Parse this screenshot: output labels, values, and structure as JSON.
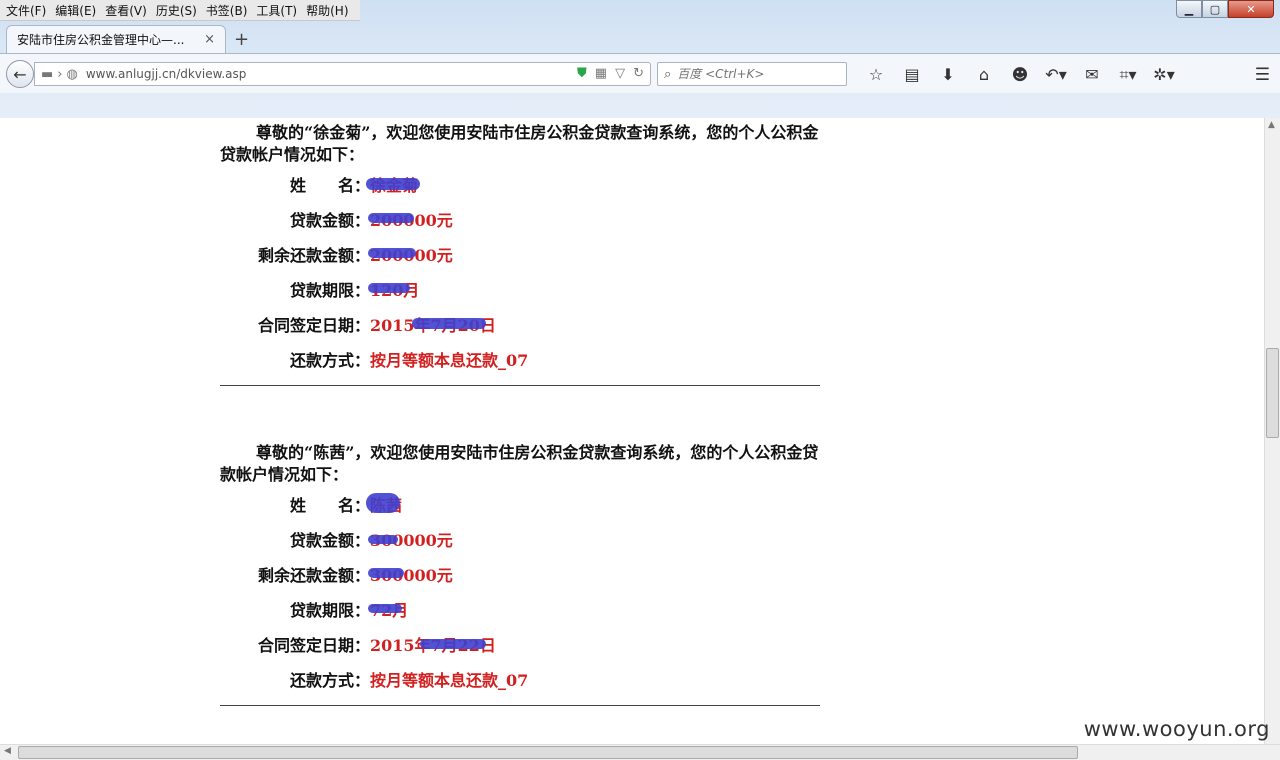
{
  "menu": [
    "文件(F)",
    "编辑(E)",
    "查看(V)",
    "历史(S)",
    "书签(B)",
    "工具(T)",
    "帮助(H)"
  ],
  "window": {
    "min": "▁",
    "max": "▢",
    "close": "✕"
  },
  "tab": {
    "title": "安陆市住房公积金管理中心—...",
    "close": "×",
    "new": "+"
  },
  "nav": {
    "url": "www.anlugjj.cn/dkview.asp",
    "search_placeholder": "百度 <Ctrl+K>"
  },
  "records": [
    {
      "intro": "尊敬的“徐金菊”，欢迎您使用安陆市住房公积金贷款查询系统，您的个人公积金贷款帐户情况如下：",
      "fields": [
        {
          "label": "姓　　名：",
          "value": "徐金菊"
        },
        {
          "label": "贷款金额：",
          "value": "200000元"
        },
        {
          "label": "剩余还款金额：",
          "value": "200000元"
        },
        {
          "label": "贷款期限：",
          "value": "120月"
        },
        {
          "label": "合同签定日期：",
          "value": "2015年7月20日"
        },
        {
          "label": "还款方式：",
          "value": "按月等额本息还款_07"
        }
      ]
    },
    {
      "intro": "尊敬的“陈茜”，欢迎您使用安陆市住房公积金贷款查询系统，您的个人公积金贷款帐户情况如下：",
      "fields": [
        {
          "label": "姓　　名：",
          "value": "陈茜"
        },
        {
          "label": "贷款金额：",
          "value": "300000元"
        },
        {
          "label": "剩余还款金额：",
          "value": "300000元"
        },
        {
          "label": "贷款期限：",
          "value": "72月"
        },
        {
          "label": "合同签定日期：",
          "value": "2015年7月22日"
        },
        {
          "label": "还款方式：",
          "value": "按月等额本息还款_07"
        }
      ]
    }
  ],
  "watermark": "www.wooyun.org"
}
